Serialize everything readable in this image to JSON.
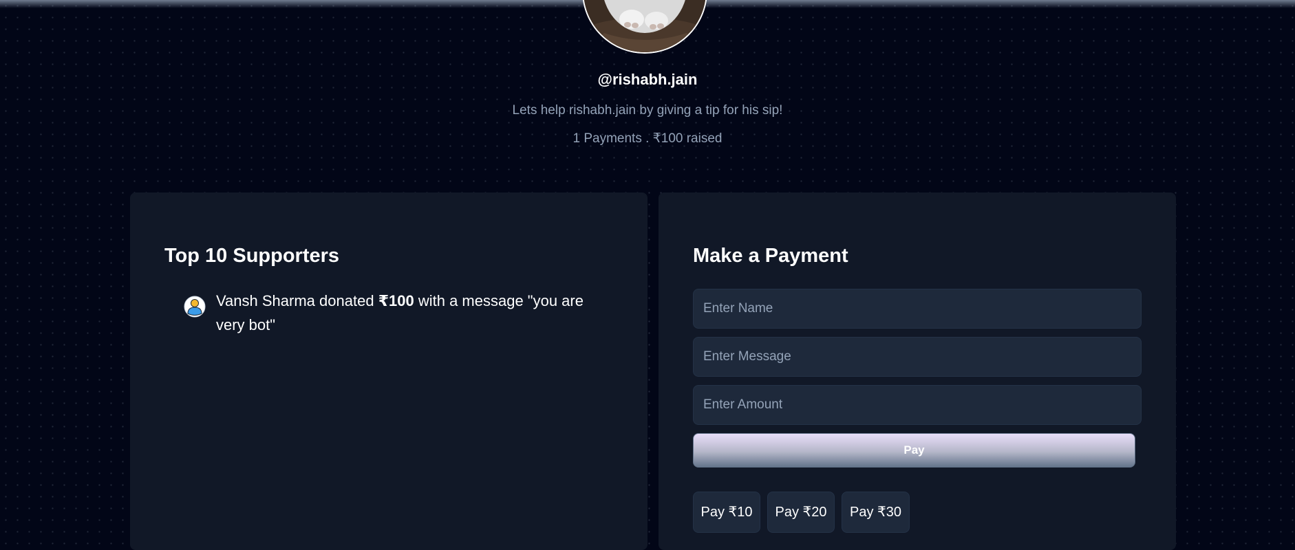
{
  "profile": {
    "handle": "@rishabh.jain",
    "tagline": "Lets help rishabh.jain by giving a tip for his sip!",
    "stats": "1 Payments . ₹100 raised"
  },
  "supporters": {
    "title": "Top 10 Supporters",
    "items": [
      {
        "name": "Vansh Sharma",
        "donated_text": "donated",
        "amount": "₹100",
        "message_text": "with a message \"you are very bot\""
      }
    ]
  },
  "payment": {
    "title": "Make a Payment",
    "name_placeholder": "Enter Name",
    "message_placeholder": "Enter Message",
    "amount_placeholder": "Enter Amount",
    "pay_label": "Pay",
    "quick_amounts": [
      "Pay ₹10",
      "Pay ₹20",
      "Pay ₹30"
    ]
  },
  "icons": {
    "profile_picture": "cat-photo",
    "supporter_avatar": "user-avatar-icon"
  },
  "colors": {
    "background": "#020617",
    "panel": "#111827",
    "input": "#1e293b",
    "muted_text": "#94a3b8",
    "pay_gradient_start": "#e9defa",
    "pay_gradient_end": "#64748b"
  }
}
